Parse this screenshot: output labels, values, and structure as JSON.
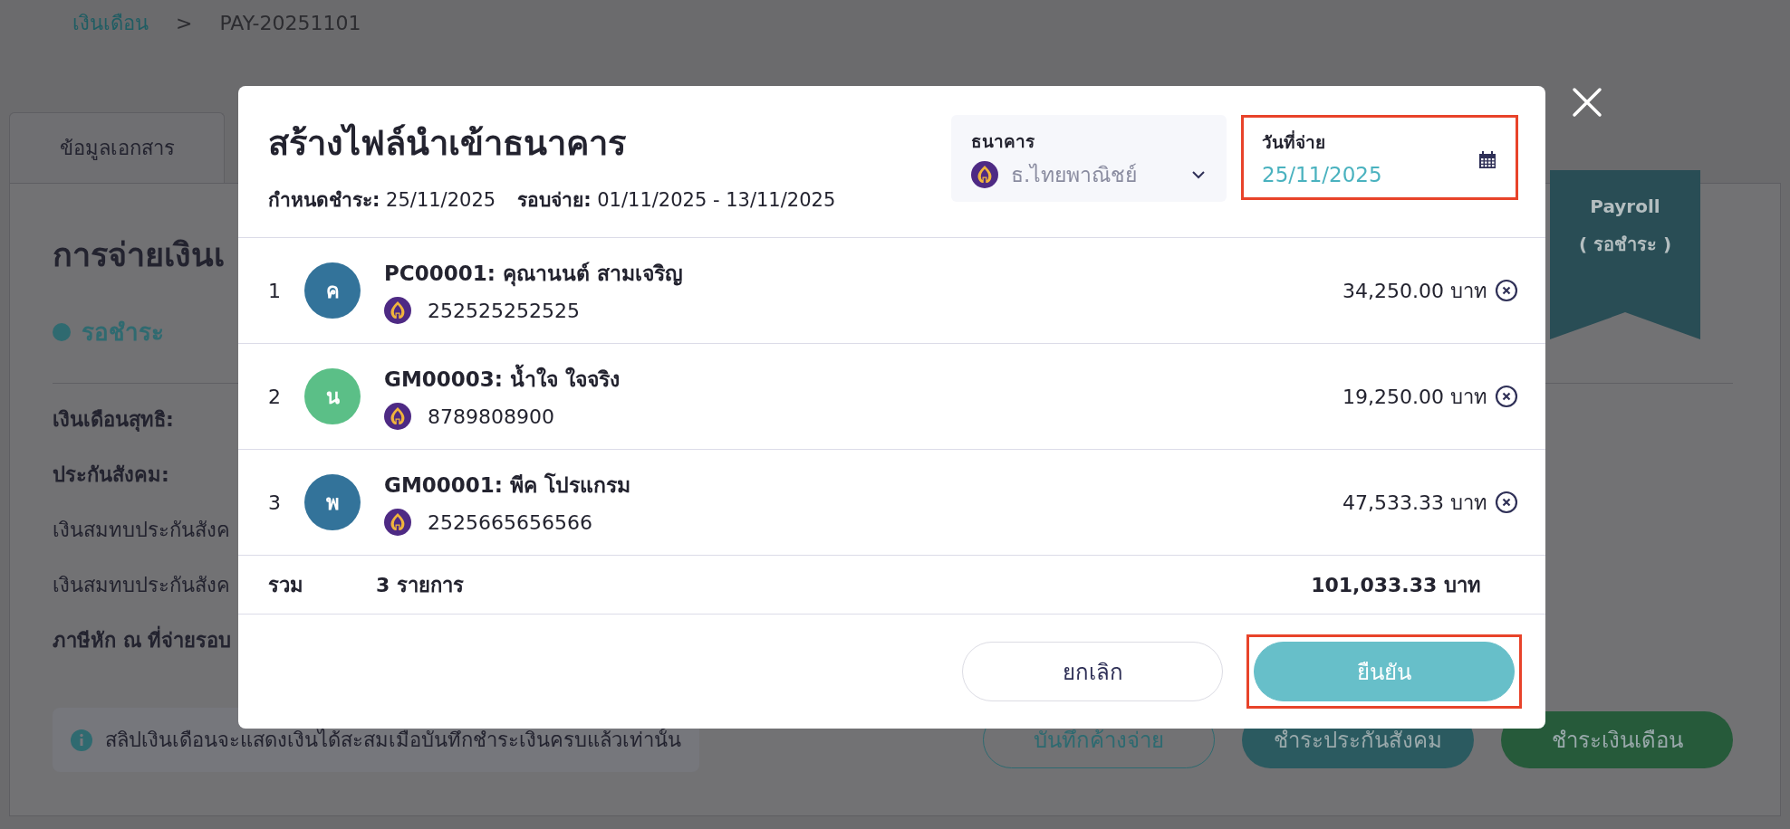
{
  "breadcrumb": {
    "parent": "เงินเดือน",
    "separator": ">",
    "current": "PAY-20251101"
  },
  "tabs": [
    {
      "label": "ข้อมูลเอกสาร",
      "selected": false
    }
  ],
  "page": {
    "title": "การจ่ายเงินเ",
    "status": {
      "label": "รอชำระ",
      "color": "#2f6a70"
    },
    "fields": [
      {
        "kind": "heading",
        "label": "เงินเดือนสุทธิ:"
      },
      {
        "kind": "heading",
        "label": "ประกันสังคม:"
      },
      {
        "kind": "item",
        "label": "เงินสมทบประกันสังค"
      },
      {
        "kind": "item",
        "label": "เงินสมทบประกันสังค"
      },
      {
        "kind": "heading",
        "label": "ภาษีหัก ณ ที่จ่ายรอบ"
      }
    ],
    "note": "สลิปเงินเดือนจะแสดงเงินได้สะสมเมื่อบันทึกชำระเงินครบแล้วเท่านั้น",
    "buttons": [
      {
        "label": "บันทึกค้างจ่าย",
        "kind": "outline"
      },
      {
        "label": "ชำระประกันสังคม",
        "kind": "teal"
      },
      {
        "label": "ชำระเงินเดือน",
        "kind": "green"
      }
    ],
    "ribbon": {
      "title": "Payroll",
      "status": "( รอชำระ )"
    }
  },
  "modal": {
    "title": "สร้างไฟล์นำเข้าธนาคาร",
    "due_label": "กำหนดชำระ:",
    "due": "25/11/2025",
    "cycle_label": "รอบจ่าย:",
    "cycle": "01/11/2025 - 13/11/2025",
    "bank": {
      "label": "ธนาคาร",
      "value": "ธ.ไทยพาณิชย์"
    },
    "pay_date": {
      "label": "วันที่จ่าย",
      "value": "25/11/2025",
      "highlighted": true
    },
    "rows": [
      {
        "index": "1",
        "initial": "ค",
        "color": "#33739a",
        "title": "PC00001: คุณานนต์ สามเจริญ",
        "account": "252525252525",
        "amount": "34,250.00 บาท"
      },
      {
        "index": "2",
        "initial": "น",
        "color": "#5bbf87",
        "title": "GM00003: น้ำใจ ใจจริง",
        "account": "8789808900",
        "amount": "19,250.00 บาท"
      },
      {
        "index": "3",
        "initial": "พ",
        "color": "#33739a",
        "title": "GM00001: พีค โปรแกรม",
        "account": "2525665656566",
        "amount": "47,533.33 บาท"
      }
    ],
    "total": {
      "label": "รวม",
      "count": "3 รายการ",
      "amount": "101,033.33 บาท"
    },
    "buttons": [
      {
        "label": "ยกเลิก",
        "kind": "outline",
        "highlighted": false
      },
      {
        "label": "ยืนยัน",
        "kind": "primary",
        "highlighted": true
      }
    ]
  }
}
